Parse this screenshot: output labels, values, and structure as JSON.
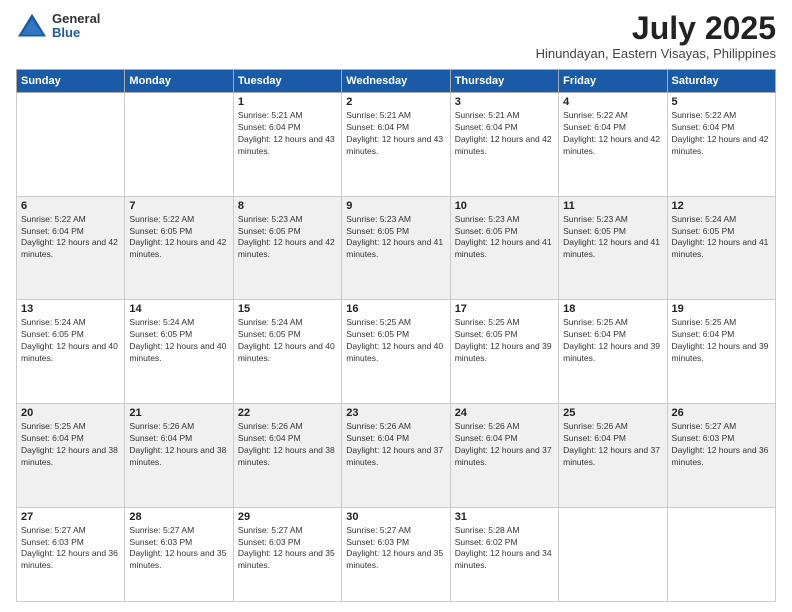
{
  "logo": {
    "general": "General",
    "blue": "Blue"
  },
  "header": {
    "month": "July 2025",
    "location": "Hinundayan, Eastern Visayas, Philippines"
  },
  "weekdays": [
    "Sunday",
    "Monday",
    "Tuesday",
    "Wednesday",
    "Thursday",
    "Friday",
    "Saturday"
  ],
  "weeks": [
    [
      {
        "day": "",
        "info": ""
      },
      {
        "day": "",
        "info": ""
      },
      {
        "day": "1",
        "sunrise": "Sunrise: 5:21 AM",
        "sunset": "Sunset: 6:04 PM",
        "daylight": "Daylight: 12 hours and 43 minutes."
      },
      {
        "day": "2",
        "sunrise": "Sunrise: 5:21 AM",
        "sunset": "Sunset: 6:04 PM",
        "daylight": "Daylight: 12 hours and 43 minutes."
      },
      {
        "day": "3",
        "sunrise": "Sunrise: 5:21 AM",
        "sunset": "Sunset: 6:04 PM",
        "daylight": "Daylight: 12 hours and 42 minutes."
      },
      {
        "day": "4",
        "sunrise": "Sunrise: 5:22 AM",
        "sunset": "Sunset: 6:04 PM",
        "daylight": "Daylight: 12 hours and 42 minutes."
      },
      {
        "day": "5",
        "sunrise": "Sunrise: 5:22 AM",
        "sunset": "Sunset: 6:04 PM",
        "daylight": "Daylight: 12 hours and 42 minutes."
      }
    ],
    [
      {
        "day": "6",
        "sunrise": "Sunrise: 5:22 AM",
        "sunset": "Sunset: 6:04 PM",
        "daylight": "Daylight: 12 hours and 42 minutes."
      },
      {
        "day": "7",
        "sunrise": "Sunrise: 5:22 AM",
        "sunset": "Sunset: 6:05 PM",
        "daylight": "Daylight: 12 hours and 42 minutes."
      },
      {
        "day": "8",
        "sunrise": "Sunrise: 5:23 AM",
        "sunset": "Sunset: 6:05 PM",
        "daylight": "Daylight: 12 hours and 42 minutes."
      },
      {
        "day": "9",
        "sunrise": "Sunrise: 5:23 AM",
        "sunset": "Sunset: 6:05 PM",
        "daylight": "Daylight: 12 hours and 41 minutes."
      },
      {
        "day": "10",
        "sunrise": "Sunrise: 5:23 AM",
        "sunset": "Sunset: 6:05 PM",
        "daylight": "Daylight: 12 hours and 41 minutes."
      },
      {
        "day": "11",
        "sunrise": "Sunrise: 5:23 AM",
        "sunset": "Sunset: 6:05 PM",
        "daylight": "Daylight: 12 hours and 41 minutes."
      },
      {
        "day": "12",
        "sunrise": "Sunrise: 5:24 AM",
        "sunset": "Sunset: 6:05 PM",
        "daylight": "Daylight: 12 hours and 41 minutes."
      }
    ],
    [
      {
        "day": "13",
        "sunrise": "Sunrise: 5:24 AM",
        "sunset": "Sunset: 6:05 PM",
        "daylight": "Daylight: 12 hours and 40 minutes."
      },
      {
        "day": "14",
        "sunrise": "Sunrise: 5:24 AM",
        "sunset": "Sunset: 6:05 PM",
        "daylight": "Daylight: 12 hours and 40 minutes."
      },
      {
        "day": "15",
        "sunrise": "Sunrise: 5:24 AM",
        "sunset": "Sunset: 6:05 PM",
        "daylight": "Daylight: 12 hours and 40 minutes."
      },
      {
        "day": "16",
        "sunrise": "Sunrise: 5:25 AM",
        "sunset": "Sunset: 6:05 PM",
        "daylight": "Daylight: 12 hours and 40 minutes."
      },
      {
        "day": "17",
        "sunrise": "Sunrise: 5:25 AM",
        "sunset": "Sunset: 6:05 PM",
        "daylight": "Daylight: 12 hours and 39 minutes."
      },
      {
        "day": "18",
        "sunrise": "Sunrise: 5:25 AM",
        "sunset": "Sunset: 6:04 PM",
        "daylight": "Daylight: 12 hours and 39 minutes."
      },
      {
        "day": "19",
        "sunrise": "Sunrise: 5:25 AM",
        "sunset": "Sunset: 6:04 PM",
        "daylight": "Daylight: 12 hours and 39 minutes."
      }
    ],
    [
      {
        "day": "20",
        "sunrise": "Sunrise: 5:25 AM",
        "sunset": "Sunset: 6:04 PM",
        "daylight": "Daylight: 12 hours and 38 minutes."
      },
      {
        "day": "21",
        "sunrise": "Sunrise: 5:26 AM",
        "sunset": "Sunset: 6:04 PM",
        "daylight": "Daylight: 12 hours and 38 minutes."
      },
      {
        "day": "22",
        "sunrise": "Sunrise: 5:26 AM",
        "sunset": "Sunset: 6:04 PM",
        "daylight": "Daylight: 12 hours and 38 minutes."
      },
      {
        "day": "23",
        "sunrise": "Sunrise: 5:26 AM",
        "sunset": "Sunset: 6:04 PM",
        "daylight": "Daylight: 12 hours and 37 minutes."
      },
      {
        "day": "24",
        "sunrise": "Sunrise: 5:26 AM",
        "sunset": "Sunset: 6:04 PM",
        "daylight": "Daylight: 12 hours and 37 minutes."
      },
      {
        "day": "25",
        "sunrise": "Sunrise: 5:26 AM",
        "sunset": "Sunset: 6:04 PM",
        "daylight": "Daylight: 12 hours and 37 minutes."
      },
      {
        "day": "26",
        "sunrise": "Sunrise: 5:27 AM",
        "sunset": "Sunset: 6:03 PM",
        "daylight": "Daylight: 12 hours and 36 minutes."
      }
    ],
    [
      {
        "day": "27",
        "sunrise": "Sunrise: 5:27 AM",
        "sunset": "Sunset: 6:03 PM",
        "daylight": "Daylight: 12 hours and 36 minutes."
      },
      {
        "day": "28",
        "sunrise": "Sunrise: 5:27 AM",
        "sunset": "Sunset: 6:03 PM",
        "daylight": "Daylight: 12 hours and 35 minutes."
      },
      {
        "day": "29",
        "sunrise": "Sunrise: 5:27 AM",
        "sunset": "Sunset: 6:03 PM",
        "daylight": "Daylight: 12 hours and 35 minutes."
      },
      {
        "day": "30",
        "sunrise": "Sunrise: 5:27 AM",
        "sunset": "Sunset: 6:03 PM",
        "daylight": "Daylight: 12 hours and 35 minutes."
      },
      {
        "day": "31",
        "sunrise": "Sunrise: 5:28 AM",
        "sunset": "Sunset: 6:02 PM",
        "daylight": "Daylight: 12 hours and 34 minutes."
      },
      {
        "day": "",
        "info": ""
      },
      {
        "day": "",
        "info": ""
      }
    ]
  ]
}
